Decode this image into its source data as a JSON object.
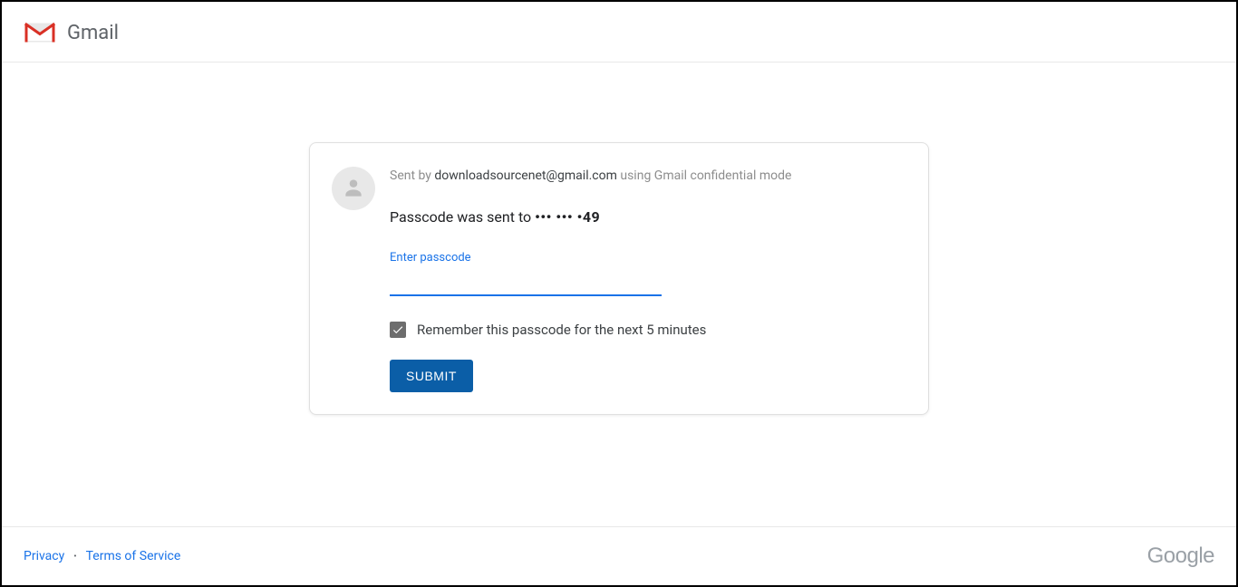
{
  "header": {
    "product_name": "Gmail"
  },
  "card": {
    "sent_by_prefix": "Sent by ",
    "sender_email": "downloadsourcenet@gmail.com",
    "sent_by_suffix": " using Gmail confidential mode",
    "passcode_prefix": "Passcode was sent to  ",
    "masked_number": "••• ••• •49",
    "input_label": "Enter passcode",
    "input_value": "",
    "remember_label": "Remember this passcode for the next 5 minutes",
    "remember_checked": true,
    "submit_label": "SUBMIT"
  },
  "footer": {
    "privacy": "Privacy",
    "terms": "Terms of Service",
    "brand": "Google"
  }
}
